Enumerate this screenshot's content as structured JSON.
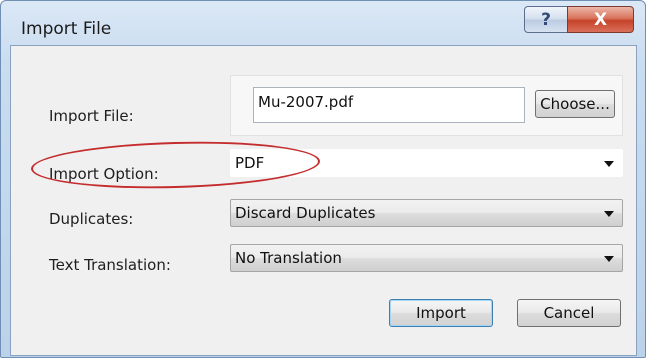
{
  "window": {
    "title": "Import File",
    "help_label": "?",
    "close_label": "X"
  },
  "form": {
    "import_file_label": "Import File:",
    "import_file_value": "Mu-2007.pdf",
    "choose_label": "Choose...",
    "import_option_label": "Import Option:",
    "import_option_value": "PDF",
    "duplicates_label": "Duplicates:",
    "duplicates_value": "Discard Duplicates",
    "text_translation_label": "Text Translation:",
    "text_translation_value": "No Translation"
  },
  "buttons": {
    "import_label": "Import",
    "cancel_label": "Cancel"
  },
  "annotation": {
    "highlight_color": "#c42d2d"
  }
}
